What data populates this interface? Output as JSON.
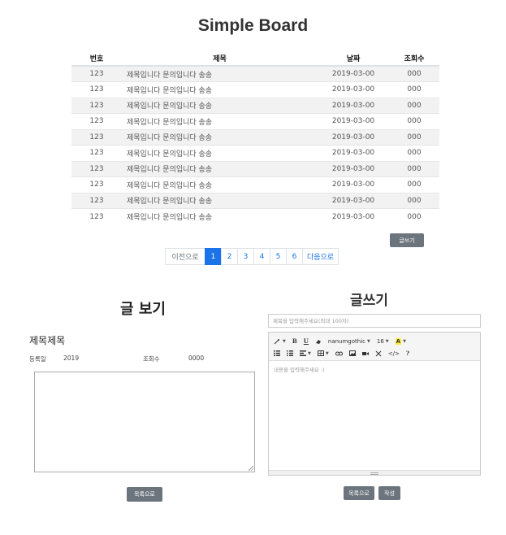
{
  "board": {
    "title": "Simple Board",
    "columns": {
      "no": "번호",
      "title": "제목",
      "date": "날짜",
      "views": "조회수"
    },
    "rows": [
      {
        "no": "123",
        "title": "제목입니다 문의입니다 송송",
        "date": "2019-03-00",
        "views": "000"
      },
      {
        "no": "123",
        "title": "제목입니다 문의입니다 송송",
        "date": "2019-03-00",
        "views": "000"
      },
      {
        "no": "123",
        "title": "제목입니다 문의입니다 송송",
        "date": "2019-03-00",
        "views": "000"
      },
      {
        "no": "123",
        "title": "제목입니다 문의입니다 송송",
        "date": "2019-03-00",
        "views": "000"
      },
      {
        "no": "123",
        "title": "제목입니다 문의입니다 송송",
        "date": "2019-03-00",
        "views": "000"
      },
      {
        "no": "123",
        "title": "제목입니다 문의입니다 송송",
        "date": "2019-03-00",
        "views": "000"
      },
      {
        "no": "123",
        "title": "제목입니다 문의입니다 송송",
        "date": "2019-03-00",
        "views": "000"
      },
      {
        "no": "123",
        "title": "제목입니다 문의입니다 송송",
        "date": "2019-03-00",
        "views": "000"
      },
      {
        "no": "123",
        "title": "제목입니다 문의입니다 송송",
        "date": "2019-03-00",
        "views": "000"
      },
      {
        "no": "123",
        "title": "제목입니다 문의입니다 송송",
        "date": "2019-03-00",
        "views": "000"
      }
    ],
    "write_button": "글쓰기"
  },
  "pagination": {
    "prev": "이전으로",
    "pages": [
      "1",
      "2",
      "3",
      "4",
      "5",
      "6"
    ],
    "active_page": "1",
    "next": "다음으로"
  },
  "view": {
    "heading": "글 보기",
    "subject": "제목제목",
    "date_label": "등록일",
    "date_value": "2019",
    "views_label": "조회수",
    "views_value": "0000",
    "list_button": "목록으로"
  },
  "write": {
    "heading": "글쓰기",
    "subject_placeholder": "제목을 입력해주세요(최대 100자)",
    "body_placeholder": "내용을 입력해주세요 :)",
    "toolbar": {
      "bold": "B",
      "underline": "U",
      "font_name": "nanumgothic",
      "font_size": "16",
      "highlight": "A",
      "code": "</>",
      "help": "?"
    },
    "list_button": "목록으로",
    "submit_button": "작성"
  },
  "colors": {
    "accent": "#1a73e8",
    "button": "#6c757d",
    "stripe": "#f2f2f2"
  }
}
